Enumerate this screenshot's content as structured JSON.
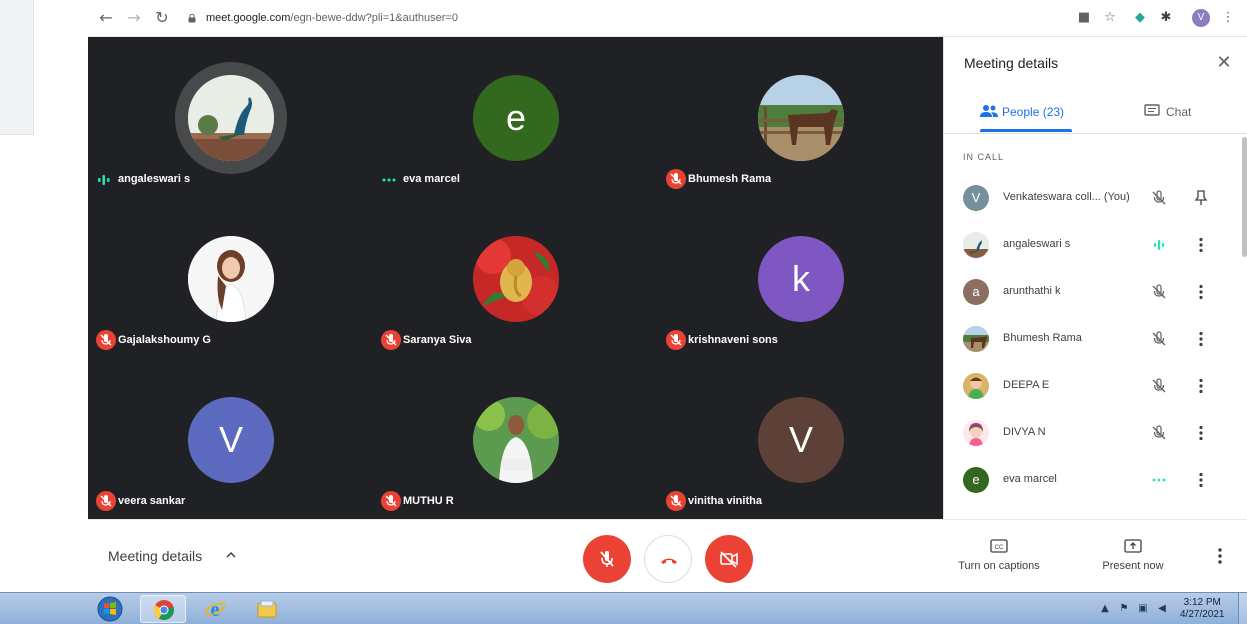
{
  "browser": {
    "url_host": "meet.google.com",
    "url_path": "/egn-bewe-ddw?pli=1&authuser=0",
    "profile_initial": "V"
  },
  "tiles": [
    {
      "name": "angaleswari s",
      "status": "speaking",
      "avatar": "peacock-photo"
    },
    {
      "name": "eva marcel",
      "status": "connecting",
      "avatar_letter": "e",
      "color": "#33691e"
    },
    {
      "name": "Bhumesh Rama",
      "status": "muted",
      "avatar": "horse-photo"
    },
    {
      "name": "Gajalakshoumy G",
      "status": "muted",
      "avatar": "woman-photo"
    },
    {
      "name": "Saranya Siva",
      "status": "muted",
      "avatar": "ganesha-photo"
    },
    {
      "name": "krishnaveni sons",
      "status": "muted",
      "avatar_letter": "k",
      "color": "#7e57c2"
    },
    {
      "name": "veera sankar",
      "status": "muted",
      "avatar_letter": "V",
      "color": "#5c6bc0"
    },
    {
      "name": "MUTHU R",
      "status": "muted",
      "avatar": "man-photo"
    },
    {
      "name": "vinitha vinitha",
      "status": "muted",
      "avatar_letter": "V",
      "color": "#5d4037"
    }
  ],
  "panel": {
    "title": "Meeting details",
    "tab_people": "People (23)",
    "tab_chat": "Chat",
    "section": "IN CALL",
    "people": [
      {
        "name": "Venkateswara coll... (You)",
        "letter": "V",
        "color": "#78909c",
        "status": "muted",
        "action": "pin"
      },
      {
        "name": "angaleswari s",
        "avatar": "peacock-photo",
        "status": "speaking",
        "action": "more"
      },
      {
        "name": "arunthathi k",
        "letter": "a",
        "color": "#8d6e63",
        "status": "muted",
        "action": "more"
      },
      {
        "name": "Bhumesh Rama",
        "avatar": "horse-photo",
        "status": "muted",
        "action": "more"
      },
      {
        "name": "DEEPA E",
        "avatar": "child-photo",
        "status": "muted",
        "action": "more"
      },
      {
        "name": "DIVYA N",
        "avatar": "cartoon-photo",
        "status": "muted",
        "action": "more"
      },
      {
        "name": "eva marcel",
        "letter": "e",
        "color": "#33691e",
        "status": "connecting",
        "action": "more"
      }
    ]
  },
  "bottom": {
    "meeting_details": "Meeting details",
    "captions": "Turn on captions",
    "present": "Present now"
  },
  "taskbar": {
    "time": "3:12 PM",
    "date": "4/27/2021"
  }
}
